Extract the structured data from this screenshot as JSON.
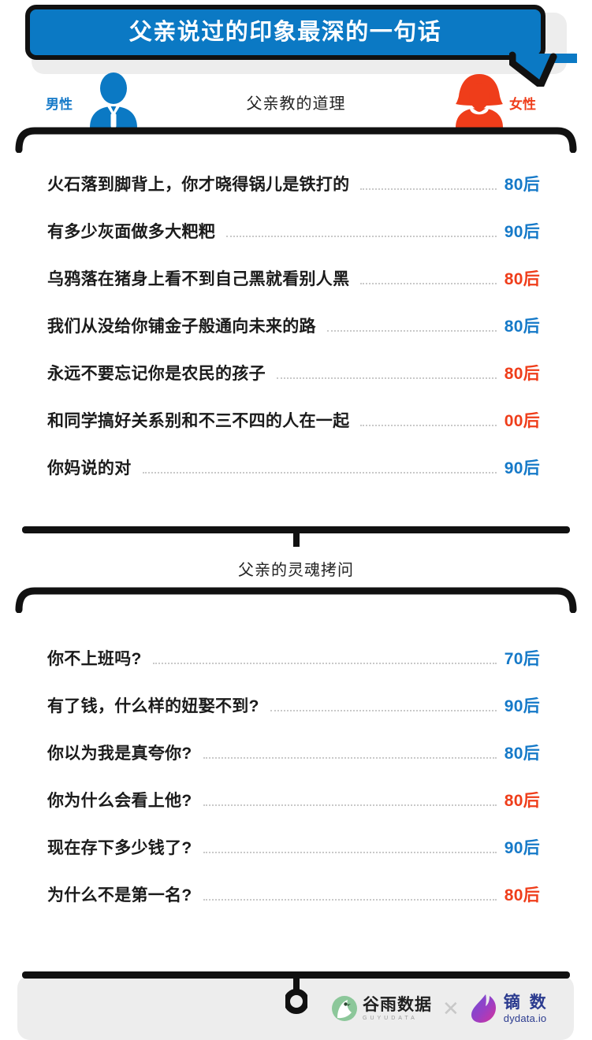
{
  "header": {
    "title": "父亲说过的印象最深的一句话"
  },
  "legend": {
    "male_label": "男性",
    "female_label": "女性",
    "male_color": "#1579c8",
    "female_color": "#ef3d1a",
    "male_icon": "male-avatar-icon",
    "female_icon": "female-avatar-icon"
  },
  "sections": [
    {
      "caption": "父亲教的道理",
      "rows": [
        {
          "text": "火石落到脚背上，你才晓得锅儿是铁打的",
          "value": "80后",
          "gender": "male"
        },
        {
          "text": "有多少灰面做多大粑粑",
          "value": "90后",
          "gender": "male"
        },
        {
          "text": "乌鸦落在猪身上看不到自己黑就看别人黑",
          "value": "80后",
          "gender": "female"
        },
        {
          "text": "我们从没给你铺金子般通向未来的路",
          "value": "80后",
          "gender": "male"
        },
        {
          "text": "永远不要忘记你是农民的孩子",
          "value": "80后",
          "gender": "female"
        },
        {
          "text": "和同学搞好关系别和不三不四的人在一起",
          "value": "00后",
          "gender": "female"
        },
        {
          "text": "你妈说的对",
          "value": "90后",
          "gender": "male"
        }
      ]
    },
    {
      "caption": "父亲的灵魂拷问",
      "rows": [
        {
          "text": "你不上班吗?",
          "value": "70后",
          "gender": "male"
        },
        {
          "text": "有了钱，什么样的妞娶不到?",
          "value": "90后",
          "gender": "male"
        },
        {
          "text": "你以为我是真夸你?",
          "value": "80后",
          "gender": "male"
        },
        {
          "text": "你为什么会看上他?",
          "value": "80后",
          "gender": "female"
        },
        {
          "text": "现在存下多少钱了?",
          "value": "90后",
          "gender": "male"
        },
        {
          "text": "为什么不是第一名?",
          "value": "80后",
          "gender": "female"
        }
      ]
    }
  ],
  "footer": {
    "brand_left_cn": "谷雨数据",
    "brand_left_en": "GUYUDATA",
    "separator": "✕",
    "brand_right_cn": "镝 数",
    "brand_right_en": "dydata.io"
  }
}
